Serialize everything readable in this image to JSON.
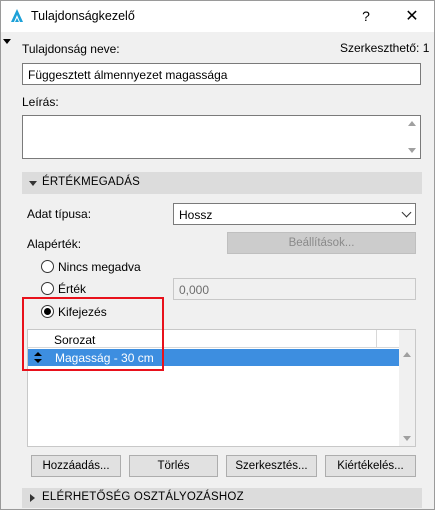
{
  "window": {
    "title": "Tulajdonságkezelő",
    "help_label": "?",
    "close_label": "✕"
  },
  "header": {
    "name_label": "Tulajdonság neve:",
    "editable_label": "Szerkeszthető: 1"
  },
  "name_field": {
    "value": "Függesztett álmennyezet magassága"
  },
  "description": {
    "label": "Leírás:",
    "value": ""
  },
  "sections": {
    "value_definition": "ÉRTÉKMEGADÁS",
    "availability": "ELÉRHETŐSÉG OSZTÁLYOZÁSHOZ"
  },
  "data_type": {
    "label": "Adat típusa:",
    "selected": "Hossz"
  },
  "default_value": {
    "label": "Alapérték:",
    "settings_button": "Beállítások..."
  },
  "options": {
    "none": "Nincs megadva",
    "value": "Érték",
    "value_input": "0,000",
    "expression": "Kifejezés",
    "selected": "expression"
  },
  "table": {
    "column_header": "Sorozat",
    "rows": [
      {
        "label": "Magasság - 30 cm",
        "selected": true
      }
    ]
  },
  "buttons": {
    "add": "Hozzáadás...",
    "delete": "Törlés",
    "edit": "Szerkesztés...",
    "evaluate": "Kiértékelés..."
  },
  "colors": {
    "selection": "#3d8ee0",
    "highlight_box": "#e8111b",
    "icon_accent": "#1da1d8"
  },
  "icons": {
    "app": "archicad-icon",
    "sort": "updown-arrows-icon",
    "collapse": "triangle-down-icon",
    "expand": "triangle-right-icon"
  }
}
